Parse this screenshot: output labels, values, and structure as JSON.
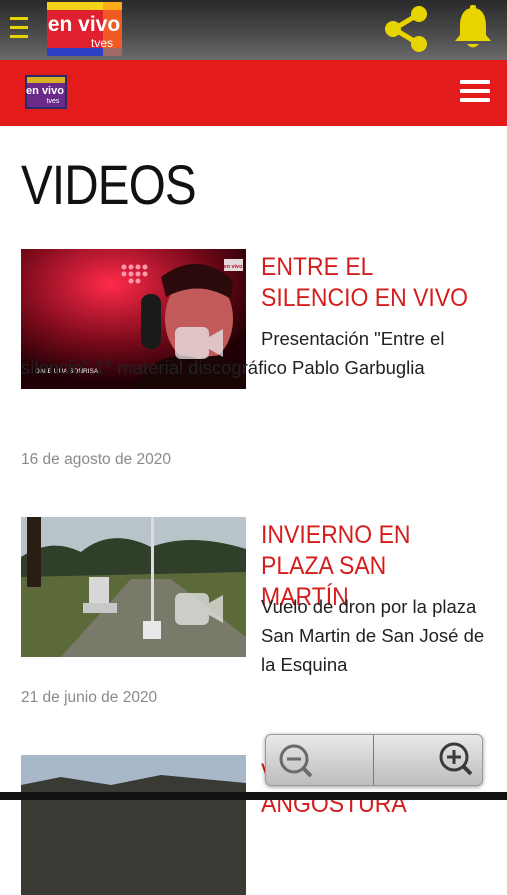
{
  "app_bar": {
    "logo_line1": "en vivo",
    "logo_line2": "tves",
    "icons": [
      "menu-icon",
      "share-icon",
      "bell-icon"
    ],
    "colors": {
      "icon_yellow": "#e8d400",
      "bar_dark": "#3a3a3a"
    }
  },
  "site_header": {
    "logo_line1": "en vivo",
    "logo_line2": "tves",
    "color": "#e31b1b"
  },
  "page": {
    "title": "VIDEOS"
  },
  "videos": [
    {
      "title": "ENTRE EL SILENCIO EN VIVO",
      "description": "Presentación \"Entre el silencio\" 1° material discográfico Pablo Garbuglia",
      "date": "16 de agosto de 2020",
      "thumb_caption": "DALE UNA SONRISA",
      "thumb_badge": "en vivo"
    },
    {
      "title": "INVIERNO EN PLAZA SAN MARTÍN",
      "description": "Vuelo de dron por la plaza San Martin de San José de la Esquina",
      "date": "21 de junio de 2020"
    },
    {
      "title": "VILLA LA ANGOSTURA"
    }
  ],
  "zoom_controls": {
    "icons": [
      "zoom-out-icon",
      "zoom-in-icon"
    ]
  }
}
